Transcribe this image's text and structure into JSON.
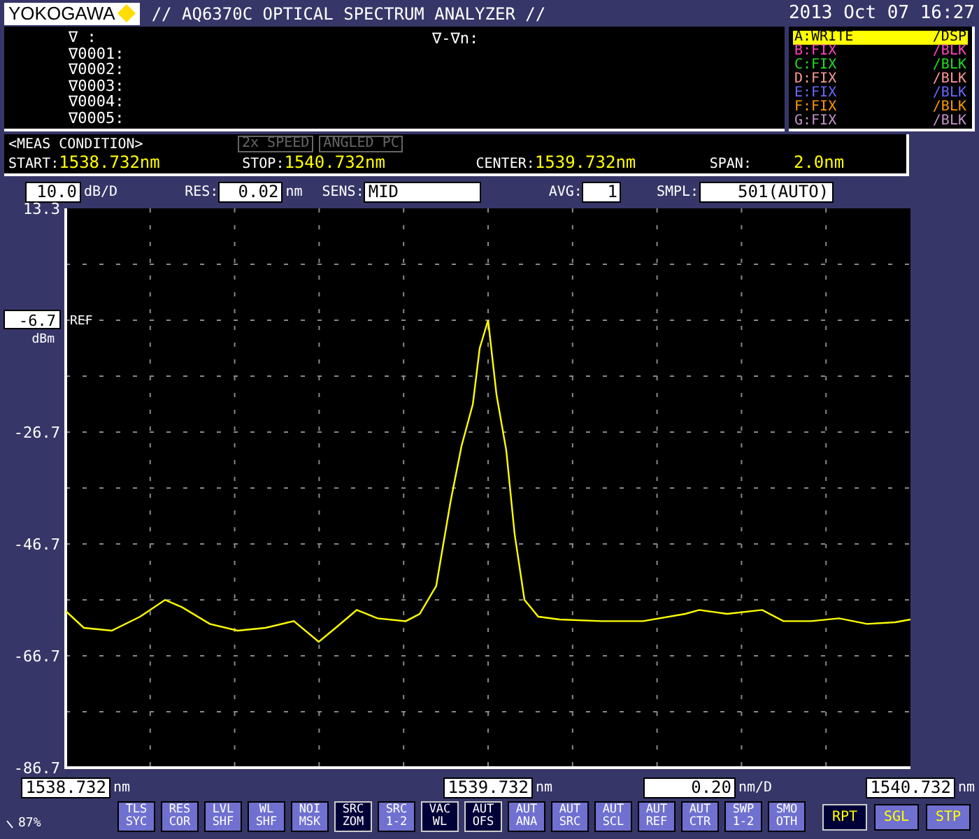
{
  "header": {
    "logo": "YOKOGAWA",
    "title": "// AQ6370C OPTICAL SPECTRUM ANALYZER //",
    "datetime": "2013 Oct 07 16:27"
  },
  "markers": {
    "items": [
      "∇    :",
      "∇0001:",
      "∇0002:",
      "∇0003:",
      "∇0004:",
      "∇0005:"
    ],
    "delta_label": "∇-∇n:"
  },
  "traces": [
    {
      "name": "A:WRITE",
      "mode": "/DSP",
      "color": "#ffff00",
      "selected": true
    },
    {
      "name": "B:FIX",
      "mode": "/BLK",
      "color": "#ff44c0",
      "selected": false
    },
    {
      "name": "C:FIX",
      "mode": "/BLK",
      "color": "#22dd22",
      "selected": false
    },
    {
      "name": "D:FIX",
      "mode": "/BLK",
      "color": "#ff9a9a",
      "selected": false
    },
    {
      "name": "E:FIX",
      "mode": "/BLK",
      "color": "#6a6aff",
      "selected": false
    },
    {
      "name": "F:FIX",
      "mode": "/BLK",
      "color": "#ff9900",
      "selected": false
    },
    {
      "name": "G:FIX",
      "mode": "/BLK",
      "color": "#c890d0",
      "selected": false
    }
  ],
  "meas_condition": {
    "title": "<MEAS CONDITION>",
    "flags": [
      {
        "label": "2x SPEED",
        "active": false
      },
      {
        "label": "ANGLED PC",
        "active": false
      }
    ],
    "params": [
      {
        "label": "START:",
        "value": "1538.732nm"
      },
      {
        "label": "STOP:",
        "value": "1540.732nm"
      },
      {
        "label": "CENTER:",
        "value": "1539.732nm"
      },
      {
        "label": "SPAN:",
        "value": "2.0nm"
      }
    ]
  },
  "settings": {
    "scale": {
      "value": "10.0",
      "unit": "dB/D"
    },
    "res": {
      "label": "RES:",
      "value": "0.02",
      "unit": "nm"
    },
    "sens": {
      "label": "SENS:",
      "value": "MID"
    },
    "avg": {
      "label": "AVG:",
      "value": "1"
    },
    "smpl": {
      "label": "SMPL:",
      "value": "501(AUTO)"
    }
  },
  "ref_level": {
    "value": "-6.7",
    "label": "REF",
    "unit": "dBm"
  },
  "chart_data": {
    "type": "line",
    "grid": true,
    "xlim": [
      1538.732,
      1540.732
    ],
    "ylim": [
      -86.7,
      13.3
    ],
    "yticks": [
      {
        "value": 13.3,
        "label": "13.3"
      },
      {
        "value": -26.7,
        "label": "-26.7"
      },
      {
        "value": -46.7,
        "label": "-46.7"
      },
      {
        "value": -66.7,
        "label": "-66.7"
      },
      {
        "value": -86.7,
        "label": "-86.7"
      }
    ],
    "xticks": [
      {
        "value": 1538.732,
        "label": "1538.732"
      },
      {
        "value": 1539.732,
        "label": "1539.732"
      },
      {
        "value": 1540.732,
        "label": "1540.732"
      }
    ],
    "x": [
      1538.732,
      1538.775,
      1538.841,
      1538.908,
      1538.967,
      1539.007,
      1539.073,
      1539.139,
      1539.205,
      1539.272,
      1539.331,
      1539.371,
      1539.421,
      1539.47,
      1539.537,
      1539.57,
      1539.609,
      1539.643,
      1539.669,
      1539.696,
      1539.712,
      1539.722,
      1539.732,
      1539.752,
      1539.775,
      1539.795,
      1539.818,
      1539.851,
      1539.901,
      1540.0,
      1540.099,
      1540.199,
      1540.232,
      1540.298,
      1540.381,
      1540.431,
      1540.497,
      1540.563,
      1540.629,
      1540.696,
      1540.732
    ],
    "series": [
      {
        "color": "#ffff00",
        "values": [
          -58.7,
          -61.7,
          -62.2,
          -59.7,
          -56.7,
          -58.0,
          -61.0,
          -62.2,
          -61.7,
          -60.5,
          -64.2,
          -61.7,
          -58.5,
          -60.0,
          -60.5,
          -59.2,
          -54.2,
          -39.2,
          -29.2,
          -21.7,
          -11.7,
          -9.2,
          -6.7,
          -20.0,
          -30.0,
          -45.0,
          -56.7,
          -59.7,
          -60.2,
          -60.5,
          -60.5,
          -59.2,
          -58.5,
          -59.2,
          -58.5,
          -60.5,
          -60.5,
          -60.0,
          -61.0,
          -60.7,
          -60.2
        ]
      }
    ]
  },
  "x_axis": {
    "tick_units": [
      "nm",
      "nm",
      "nm"
    ],
    "span_per_div": "0.20",
    "div_unit": "nm/D"
  },
  "status": {
    "memory": "87%"
  },
  "softkeys": [
    {
      "lines": [
        "TLS",
        "SYC"
      ],
      "on": false
    },
    {
      "lines": [
        "RES",
        "COR"
      ],
      "on": false
    },
    {
      "lines": [
        "LVL",
        "SHF"
      ],
      "on": false
    },
    {
      "lines": [
        "WL",
        "SHF"
      ],
      "on": false
    },
    {
      "lines": [
        "NOI",
        "MSK"
      ],
      "on": false
    },
    {
      "lines": [
        "SRC",
        "ZOM"
      ],
      "on": true
    },
    {
      "lines": [
        "SRC",
        "1-2"
      ],
      "on": false
    },
    {
      "lines": [
        "VAC",
        "WL"
      ],
      "on": true
    },
    {
      "lines": [
        "AUT",
        "OFS"
      ],
      "on": true
    },
    {
      "lines": [
        "AUT",
        "ANA"
      ],
      "on": false
    },
    {
      "lines": [
        "AUT",
        "SRC"
      ],
      "on": false
    },
    {
      "lines": [
        "AUT",
        "SCL"
      ],
      "on": false
    },
    {
      "lines": [
        "AUT",
        "REF"
      ],
      "on": false
    },
    {
      "lines": [
        "AUT",
        "CTR"
      ],
      "on": false
    },
    {
      "lines": [
        "SWP",
        "1-2"
      ],
      "on": false
    },
    {
      "lines": [
        "SMO",
        "OTH"
      ],
      "on": false
    }
  ],
  "sweep_keys": [
    {
      "label": "RPT",
      "selected": true
    },
    {
      "label": "SGL",
      "selected": false
    },
    {
      "label": "STP",
      "selected": false
    }
  ]
}
